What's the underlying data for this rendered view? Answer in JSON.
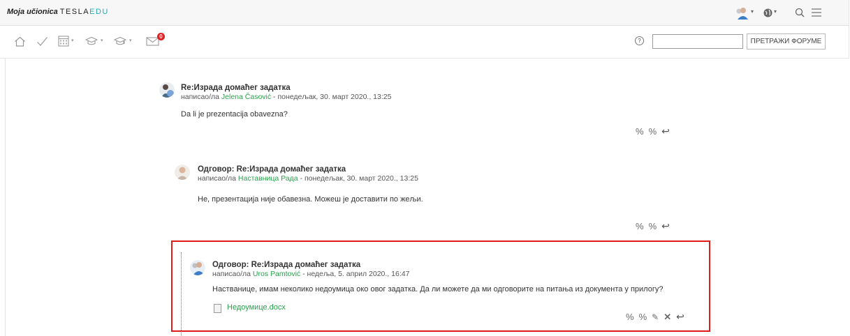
{
  "header": {
    "brand": "Moja učionica",
    "logo_left": "TESLA",
    "logo_right": "EDU",
    "icons": [
      "user-avatar-icon",
      "globe-icon",
      "search-icon",
      "hamburger-menu-icon"
    ]
  },
  "toolbar": {
    "icons": [
      "home-icon",
      "checkmark-icon",
      "calendar-icon",
      "graduation-cap-icon",
      "graduation-cap-icon",
      "mail-icon"
    ],
    "mail_count": "0",
    "search_placeholder": "",
    "search_button": "ПРЕТРАЖИ ФОРУМЕ"
  },
  "posts": [
    {
      "subject": "Re:Израда домаћег задатка",
      "by_prefix": "написао/ла ",
      "author": "Jelena Časović",
      "date": " - понедељак, 30. март 2020., 13:25",
      "body": "Da li je prezentacija obavezna?",
      "actions": [
        "permalink-icon",
        "parent-link-icon",
        "reply-icon"
      ]
    },
    {
      "subject": "Одговор: Re:Израда домаћег задатка",
      "by_prefix": "написао/ла ",
      "author": "Наставница Рада",
      "date": " - понедељак, 30. март 2020., 13:25",
      "body": "Не, презентација није обавезна. Можеш је доставити по жељи.",
      "actions": [
        "permalink-icon",
        "parent-link-icon",
        "reply-icon"
      ]
    },
    {
      "subject": "Одговор: Re:Израда домаћег задатка",
      "by_prefix": "написао/ла ",
      "author": "Uros Pamtović",
      "date": " - недеља, 5. април 2020., 16:47",
      "body": "Наствaнице, имам неколико недоумица око овог задатка. Да ли можете да ми одговорите на питања из документа у прилогу?",
      "attachment": "Недоумице.docx",
      "actions": [
        "permalink-icon",
        "parent-link-icon",
        "edit-icon",
        "delete-icon",
        "reply-icon"
      ]
    }
  ],
  "colors": {
    "link_green": "#27a14a",
    "highlight_red": "#e01b1b",
    "badge_red": "#e02020",
    "logo_teal": "#25a8b5"
  }
}
